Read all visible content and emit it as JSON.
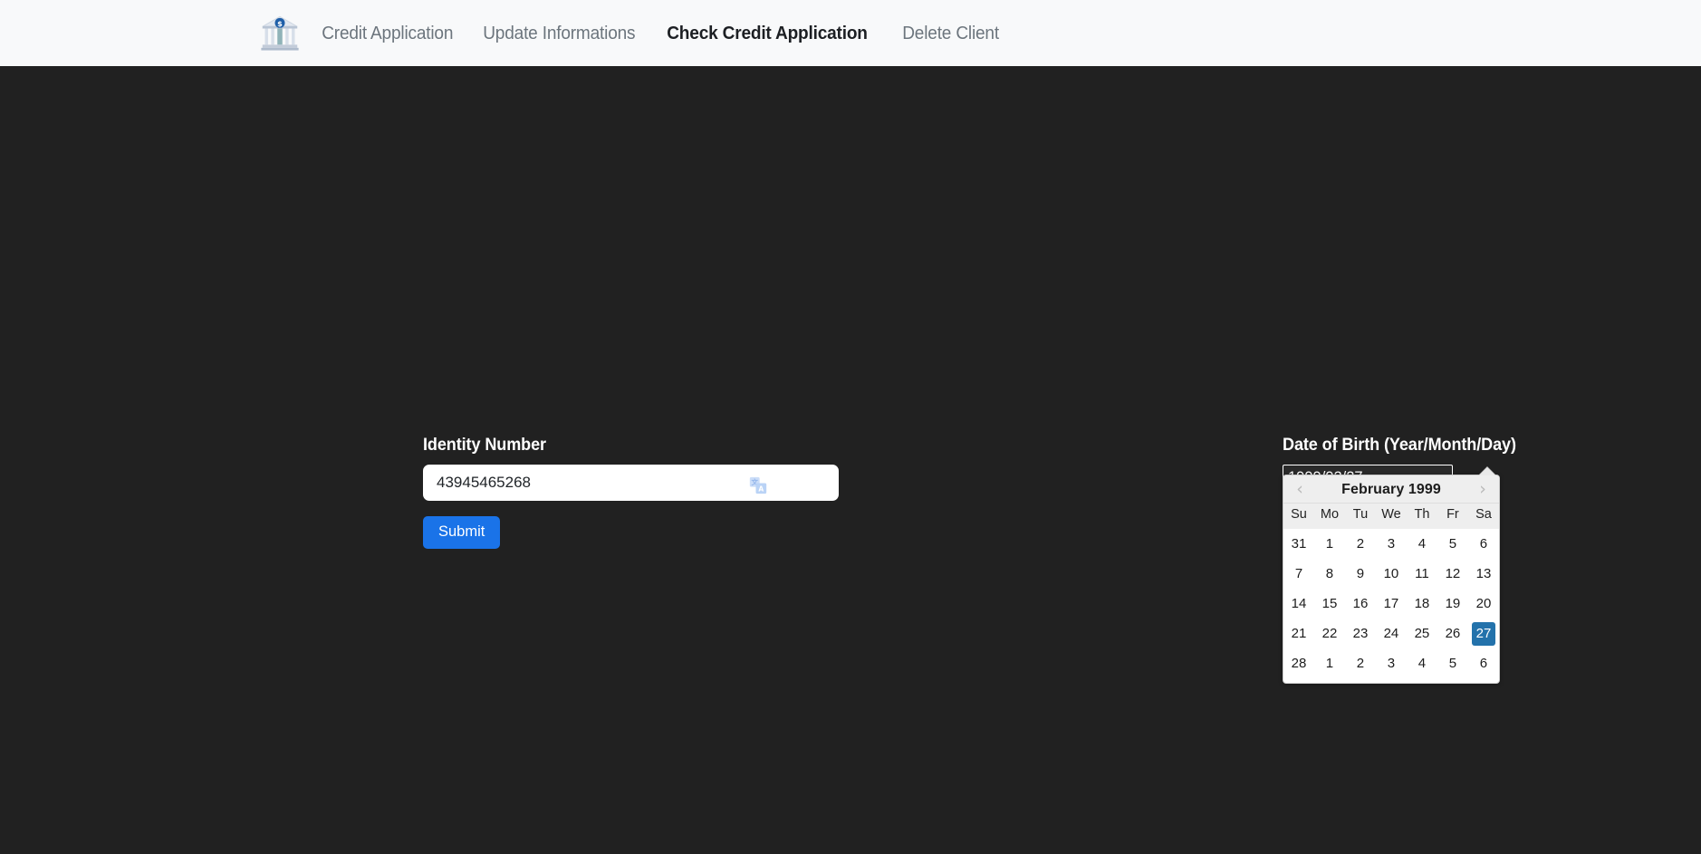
{
  "navbar": {
    "logo_icon": "bank-building-icon",
    "links": [
      {
        "label": "Credit Application",
        "active": false
      },
      {
        "label": "Update Informations",
        "active": false
      },
      {
        "label": "Check Credit Application",
        "active": true
      },
      {
        "label": "Delete Client",
        "active": false
      }
    ]
  },
  "form": {
    "identity": {
      "label": "Identity Number",
      "value": "43945465268",
      "placeholder": "",
      "translate_icon": "google-translate-icon"
    },
    "submit_label": "Submit",
    "dob": {
      "label": "Date of Birth (Year/Month/Day)",
      "value": "1999/02/27",
      "placeholder": ""
    }
  },
  "datepicker": {
    "title": "February 1999",
    "prev_icon": "chevron-left-icon",
    "next_icon": "chevron-right-icon",
    "weekdays": [
      "Su",
      "Mo",
      "Tu",
      "We",
      "Th",
      "Fr",
      "Sa"
    ],
    "selected_day": "27",
    "weeks": [
      [
        "31",
        "1",
        "2",
        "3",
        "4",
        "5",
        "6"
      ],
      [
        "7",
        "8",
        "9",
        "10",
        "11",
        "12",
        "13"
      ],
      [
        "14",
        "15",
        "16",
        "17",
        "18",
        "19",
        "20"
      ],
      [
        "21",
        "22",
        "23",
        "24",
        "25",
        "26",
        "27"
      ],
      [
        "28",
        "1",
        "2",
        "3",
        "4",
        "5",
        "6"
      ]
    ],
    "selected_week_index": 3,
    "selected_cell_index": 6
  },
  "colors": {
    "page_background": "#212121",
    "navbar_background": "#f8f9fa",
    "accent_button": "#1a73e8",
    "datepicker_selected": "#2372ab",
    "nav_inactive_text": "#6c757d",
    "nav_active_text": "#1c1f23"
  }
}
